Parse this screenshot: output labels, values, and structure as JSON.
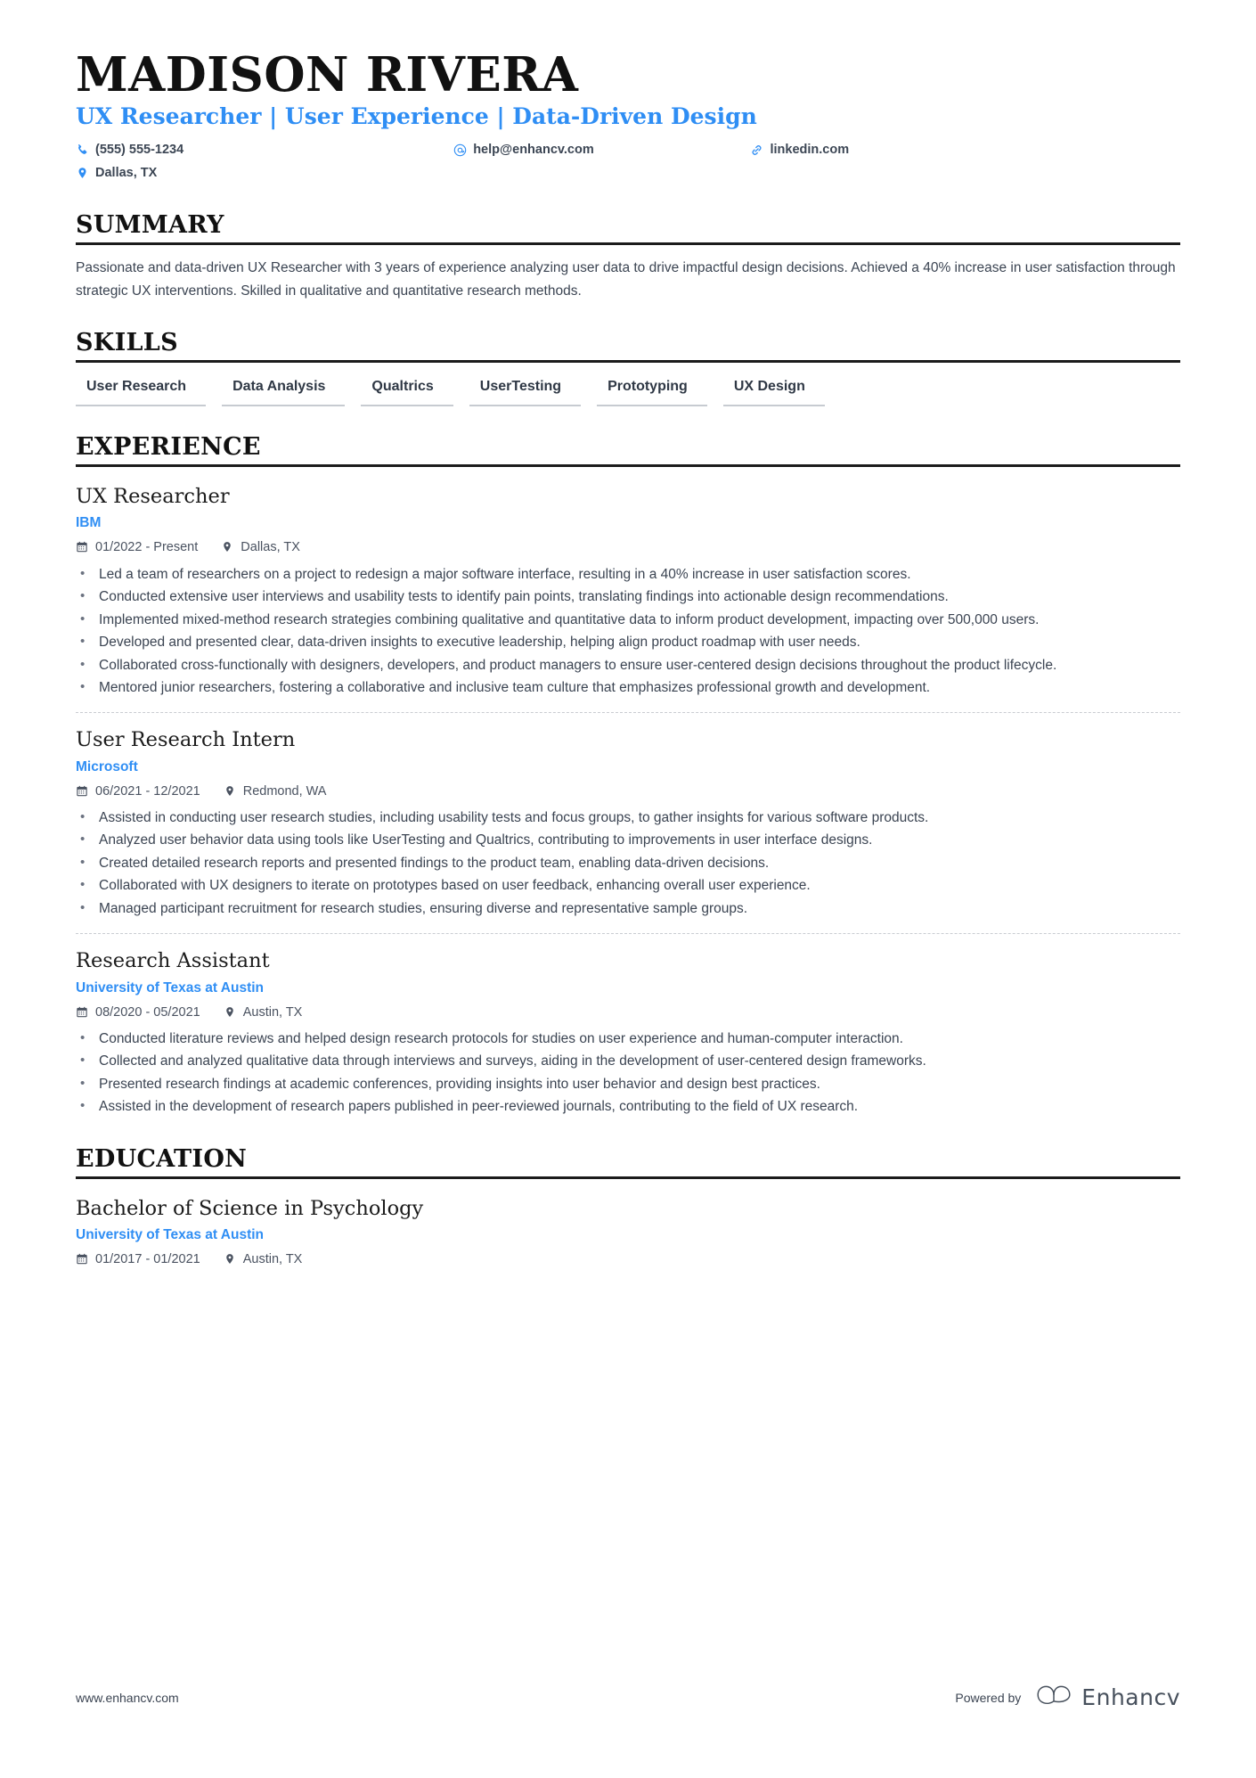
{
  "header": {
    "name": "MADISON RIVERA",
    "headline": "UX Researcher | User Experience | Data-Driven Design",
    "accent_color": "#2f8ef4",
    "contacts": [
      {
        "icon": "phone-icon",
        "value": "(555) 555-1234"
      },
      {
        "icon": "email-icon",
        "value": "help@enhancv.com"
      },
      {
        "icon": "link-icon",
        "value": "linkedin.com"
      },
      {
        "icon": "location-icon",
        "value": "Dallas, TX"
      }
    ]
  },
  "summary": {
    "title": "SUMMARY",
    "text": "Passionate and data-driven UX Researcher with 3 years of experience analyzing user data to drive impactful design decisions. Achieved a 40% increase in user satisfaction through strategic UX interventions. Skilled in qualitative and quantitative research methods."
  },
  "skills": {
    "title": "SKILLS",
    "items": [
      "User Research",
      "Data Analysis",
      "Qualtrics",
      "UserTesting",
      "Prototyping",
      "UX Design"
    ]
  },
  "experience": {
    "title": "EXPERIENCE",
    "entries": [
      {
        "role": "UX Researcher",
        "company": "IBM",
        "dates": "01/2022 - Present",
        "location": "Dallas, TX",
        "bullets": [
          "Led a team of researchers on a project to redesign a major software interface, resulting in a 40% increase in user satisfaction scores.",
          "Conducted extensive user interviews and usability tests to identify pain points, translating findings into actionable design recommendations.",
          "Implemented mixed-method research strategies combining qualitative and quantitative data to inform product development, impacting over 500,000 users.",
          "Developed and presented clear, data-driven insights to executive leadership, helping align product roadmap with user needs.",
          "Collaborated cross-functionally with designers, developers, and product managers to ensure user-centered design decisions throughout the product lifecycle.",
          "Mentored junior researchers, fostering a collaborative and inclusive team culture that emphasizes professional growth and development."
        ]
      },
      {
        "role": "User Research Intern",
        "company": "Microsoft",
        "dates": "06/2021 - 12/2021",
        "location": "Redmond, WA",
        "bullets": [
          "Assisted in conducting user research studies, including usability tests and focus groups, to gather insights for various software products.",
          "Analyzed user behavior data using tools like UserTesting and Qualtrics, contributing to improvements in user interface designs.",
          "Created detailed research reports and presented findings to the product team, enabling data-driven decisions.",
          "Collaborated with UX designers to iterate on prototypes based on user feedback, enhancing overall user experience.",
          "Managed participant recruitment for research studies, ensuring diverse and representative sample groups."
        ]
      },
      {
        "role": "Research Assistant",
        "company": "University of Texas at Austin",
        "dates": "08/2020 - 05/2021",
        "location": "Austin, TX",
        "bullets": [
          "Conducted literature reviews and helped design research protocols for studies on user experience and human-computer interaction.",
          "Collected and analyzed qualitative data through interviews and surveys, aiding in the development of user-centered design frameworks.",
          "Presented research findings at academic conferences, providing insights into user behavior and design best practices.",
          "Assisted in the development of research papers published in peer-reviewed journals, contributing to the field of UX research."
        ]
      }
    ]
  },
  "education": {
    "title": "EDUCATION",
    "entries": [
      {
        "degree": "Bachelor of Science in Psychology",
        "school": "University of Texas at Austin",
        "dates": "01/2017 - 01/2021",
        "location": "Austin, TX"
      }
    ]
  },
  "footer": {
    "url": "www.enhancv.com",
    "powered_by": "Powered by",
    "brand": "Enhancv"
  }
}
